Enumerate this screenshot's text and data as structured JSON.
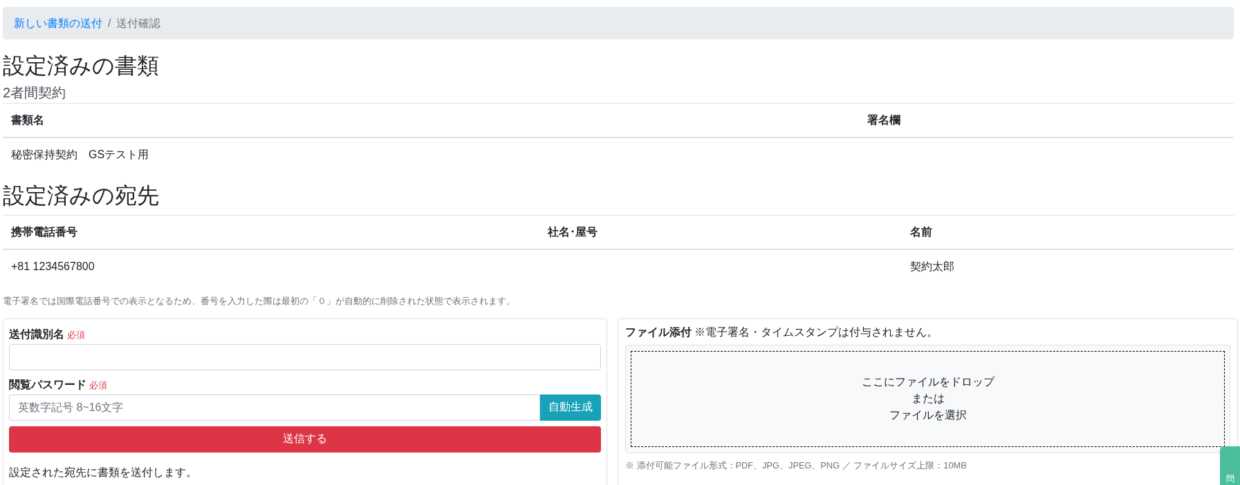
{
  "breadcrumb": {
    "separator": "/",
    "items": [
      {
        "label": "新しい書類の送付",
        "kind": "link"
      },
      {
        "label": "送付確認",
        "kind": "current"
      }
    ]
  },
  "documents": {
    "heading": "設定済みの書類",
    "subheading": "2者間契約",
    "table": {
      "columns": [
        "書類名",
        "署名欄"
      ],
      "rows": [
        [
          "秘密保持契約　GSテスト用",
          null
        ]
      ]
    }
  },
  "recipients": {
    "heading": "設定済みの宛先",
    "table": {
      "columns": [
        "携帯電話番号",
        "社名･屋号",
        "名前"
      ],
      "rows": [
        [
          "+81 1234567800",
          null,
          "契約太郎"
        ]
      ]
    },
    "note": "電子署名では国際電話番号での表示となるため、番号を入力した際は最初の「０」が自動的に削除された状態で表示されます。"
  },
  "send_form": {
    "fields": [
      {
        "label": "送付識別名",
        "required_label": "必須"
      },
      {
        "label": "閲覧パスワード",
        "required_label": "必須",
        "placeholder": "英数字記号 8~16文字",
        "button": "自動生成"
      }
    ],
    "submit": "送信する",
    "description": "設定された宛先に書類を送付します。"
  },
  "attachment": {
    "title": "**ファイル添付** ※電子署名・タイムスタンプは付与されません。",
    "dropzone_lines": [
      "ここにファイルをドロップ",
      "または",
      "ファイルを選択"
    ],
    "note": "※ 添付可能ファイル形式：PDF、JPG、JPEG、PNG ／ ファイルサイズ上限：10MB"
  },
  "side_tab": {
    "label": "問"
  }
}
